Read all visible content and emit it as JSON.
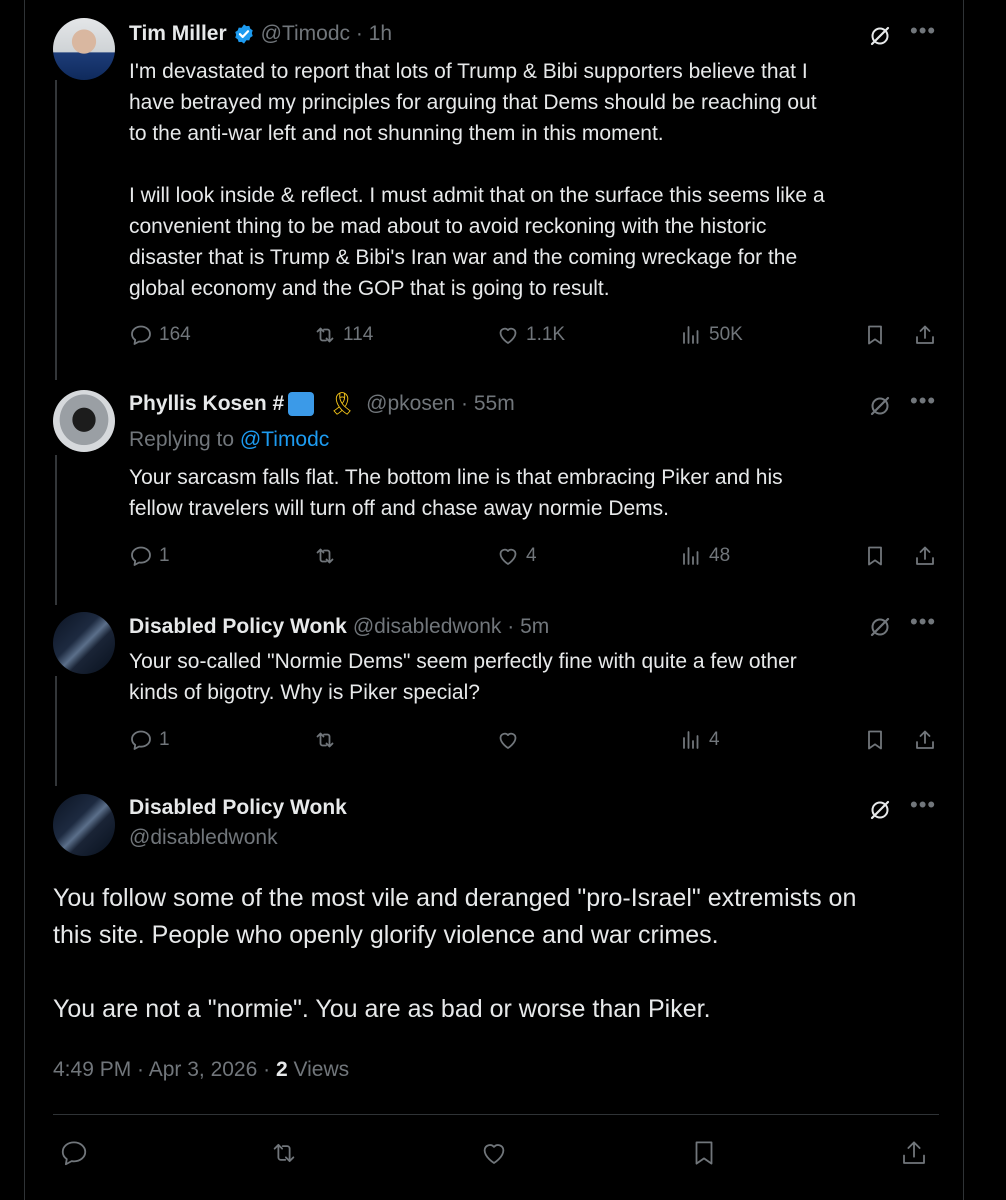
{
  "colors": {
    "background": "#000000",
    "text": "#e7e9ea",
    "muted": "#71767b",
    "link": "#1d9bf0",
    "verified": "#1d9bf0"
  },
  "tweet1": {
    "name": "Tim Miller",
    "handle": "@Timodc · 1h",
    "text": "I'm devastated to report that lots of Trump & Bibi supporters believe that I\nhave betrayed my principles for arguing that Dems should be reaching out\nto the anti-war left and not shunning them in this moment.\n\nI will look inside & reflect. I must admit that on the surface this seems like a\nconvenient thing to be mad about to avoid reckoning with the historic\ndisaster that is Trump & Bibi's Iran war and the coming wreckage for the\nglobal economy and the GOP that is going to result.",
    "replies": "164",
    "reposts": "114",
    "likes": "1.1K",
    "views": "50K"
  },
  "tweet2": {
    "name": "Phyllis Kosen #",
    "handle": "@pkosen · 55m",
    "replying_label": "Replying to",
    "replying_handle": "@Timodc",
    "text": "Your sarcasm falls flat. The bottom line is that embracing Piker and his\nfellow travelers will turn off and chase away normie Dems.",
    "replies": "1",
    "reposts": "",
    "likes": "4",
    "views": "48"
  },
  "tweet3": {
    "name": "Disabled Policy Wonk",
    "handle": "@disabledwonk · 5m",
    "text": "Your so-called \"Normie Dems\" seem perfectly fine with quite a few other\nkinds of bigotry. Why is Piker special?",
    "replies": "1",
    "reposts": "",
    "likes": "",
    "views": "4"
  },
  "focus": {
    "name": "Disabled Policy Wonk",
    "handle": "@disabledwonk",
    "text": "You follow some of the most vile and deranged \"pro-Israel\" extremists on\nthis site. People who openly glorify violence and war crimes.\n\nYou are not a \"normie\". You are as bad or worse than Piker.",
    "timestamp": "4:49 PM · Apr 3, 2026 · ",
    "views_count": "2",
    "views_label": " Views"
  },
  "icons": [
    "verified-badge-icon",
    "grok-icon",
    "more-icon",
    "reply-icon",
    "repost-icon",
    "like-icon",
    "views-icon",
    "bookmark-icon",
    "share-icon",
    "ribbon-emoji-icon"
  ]
}
